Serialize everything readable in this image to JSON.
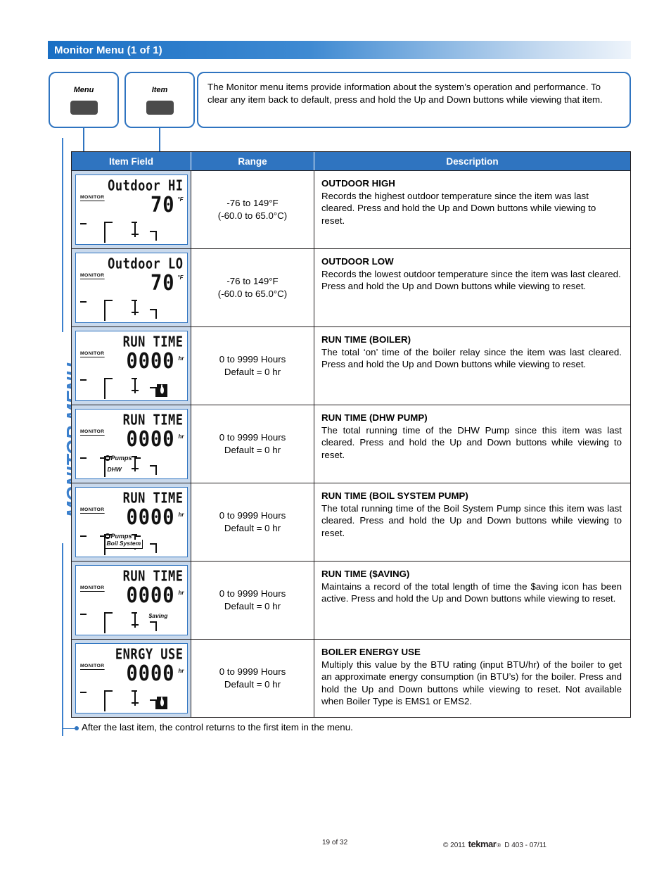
{
  "header": {
    "title": "Monitor Menu (1 of 1)"
  },
  "sidebar": {
    "label": "MONITOR MENU"
  },
  "callouts": {
    "menu_button": {
      "label": "Menu",
      "icon": "button-key-icon"
    },
    "item_button": {
      "label": "Item",
      "icon": "button-key-icon"
    },
    "description": "The Monitor menu items provide information about the system’s operation and performance. To clear any item back to default, press and hold the Up and Down buttons while viewing that item."
  },
  "table": {
    "columns": [
      "Item Field",
      "Range",
      "Description"
    ],
    "rows": [
      {
        "lcd": {
          "title": "Outdoor HI",
          "mode": "MONITOR",
          "value": "70",
          "unit": "°F",
          "icons": []
        },
        "range": [
          "-76 to 149°F",
          "(-60.0 to 65.0°C)"
        ],
        "title": "OUTDOOR HIGH",
        "body": "Records the highest outdoor temperature since the item was last cleared. Press and hold the Up and Down buttons while viewing to reset."
      },
      {
        "lcd": {
          "title": "Outdoor LO",
          "mode": "MONITOR",
          "value": "70",
          "unit": "°F",
          "icons": []
        },
        "range": [
          "-76 to 149°F",
          "(-60.0 to 65.0°C)"
        ],
        "title": "OUTDOOR LOW",
        "body": "Records the lowest outdoor temperature since the item was last cleared. Press and hold the Up and Down buttons while viewing to reset."
      },
      {
        "lcd": {
          "title": "RUN TIME",
          "mode": "MONITOR",
          "value": "0000",
          "unit": "hr",
          "icons": [
            "boiler-icon"
          ]
        },
        "range": [
          "0 to 9999 Hours",
          "Default = 0 hr"
        ],
        "title": "RUN TIME (BOILER)",
        "body": "The total ‘on’ time of the boiler relay since the item was last cleared. Press and hold the Up and Down buttons while viewing to reset."
      },
      {
        "lcd": {
          "title": "RUN TIME",
          "mode": "MONITOR",
          "value": "0000",
          "unit": "hr",
          "icons": [
            "pumps-icon"
          ],
          "pumps_label": "Pumps",
          "sub_label": "DHW"
        },
        "range": [
          "0 to 9999 Hours",
          "Default = 0 hr"
        ],
        "title": "RUN TIME (DHW PUMP)",
        "body": "The total running time of the DHW Pump since this item was last cleared. Press and hold the Up and Down buttons while viewing to reset."
      },
      {
        "lcd": {
          "title": "RUN TIME",
          "mode": "MONITOR",
          "value": "0000",
          "unit": "hr",
          "icons": [
            "pumps-icon"
          ],
          "pumps_label": "Pumps",
          "sub_label": "Boil System"
        },
        "range": [
          "0 to 9999 Hours",
          "Default = 0 hr"
        ],
        "title": "RUN TIME (BOIL SYSTEM PUMP)",
        "body": "The total running time of the Boil System Pump since this item was last cleared. Press and hold the Up and Down buttons while viewing to reset."
      },
      {
        "lcd": {
          "title": "RUN TIME",
          "mode": "MONITOR",
          "value": "0000",
          "unit": "hr",
          "icons": [],
          "saving_label": "$aving"
        },
        "range": [
          "0 to 9999 Hours",
          "Default = 0 hr"
        ],
        "title": "RUN TIME ($AVING)",
        "body": "Maintains a record of the total length of time the $aving icon has been active. Press and hold the Up and Down buttons while viewing to reset."
      },
      {
        "lcd": {
          "title": "ENRGY USE",
          "mode": "MONITOR",
          "value": "0000",
          "unit": "hr",
          "icons": [
            "boiler-icon"
          ]
        },
        "range": [
          "0 to 9999 Hours",
          "Default = 0 hr"
        ],
        "title": "BOILER ENERGY USE",
        "body": "Multiply this value by the BTU rating (input BTU/hr) of the boiler to get an approximate energy consumption (in BTU’s) for the boiler. Press and hold the Up and Down buttons while viewing to reset. Not available when Boiler Type is EMS1 or EMS2."
      }
    ]
  },
  "footnote": "After the last item, the control returns to the first item in the menu.",
  "footer": {
    "page": "19 of 32",
    "copyright": "© 2011",
    "brand": "tekmar",
    "brand_mark": "®",
    "doc": "D 403 - 07/11"
  },
  "colors": {
    "accent": "#2f74c0",
    "header_blue": "#1a6fc4",
    "lcd_cell_bg": "#c9d9ec"
  }
}
